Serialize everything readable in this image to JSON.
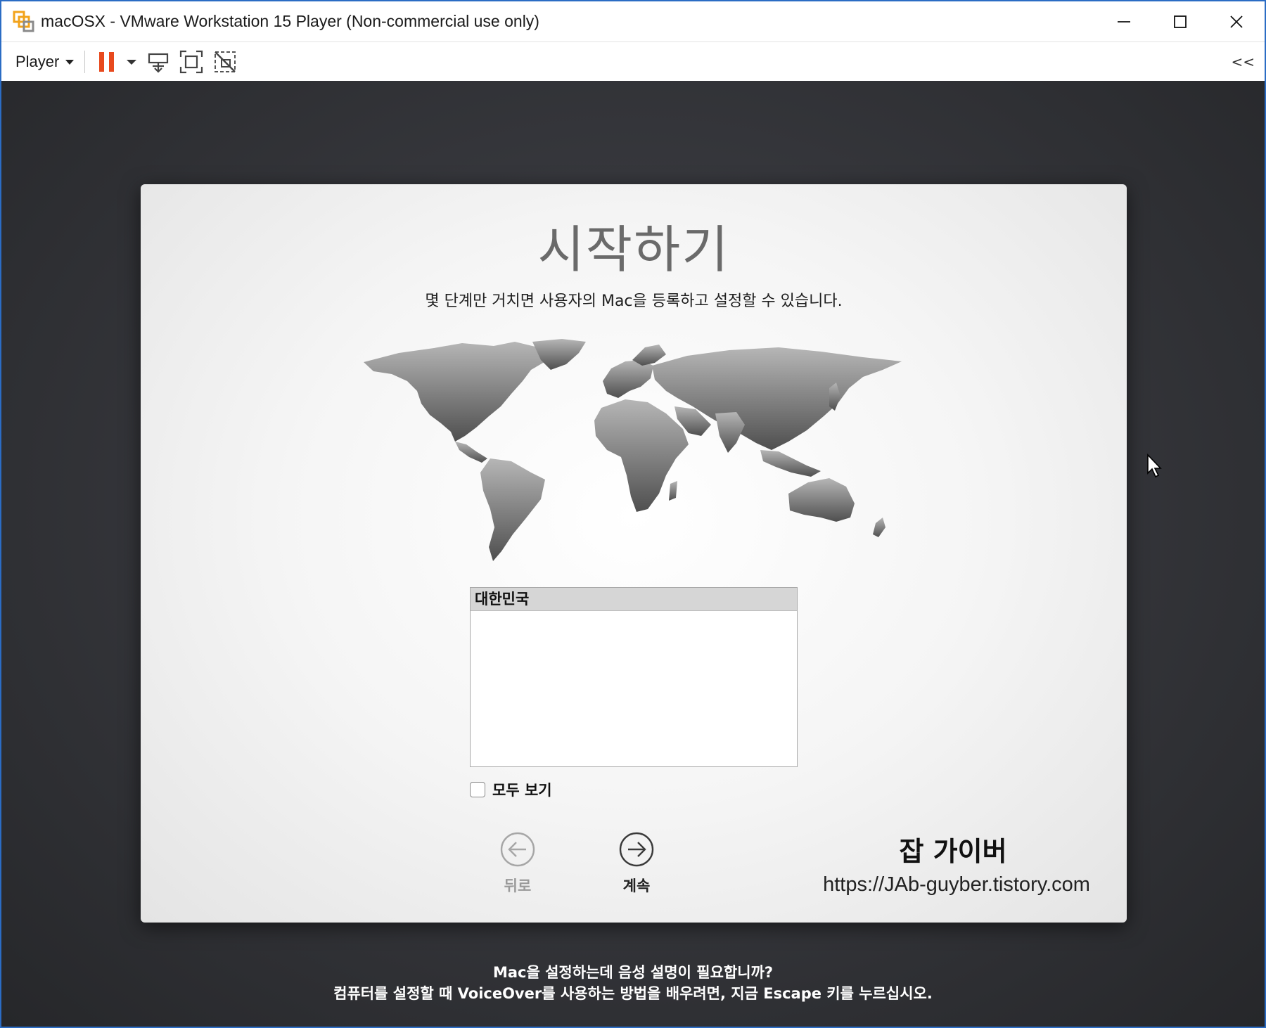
{
  "window": {
    "title": "macOSX - VMware Workstation 15 Player (Non-commercial use only)",
    "controls": [
      "minimize-icon",
      "maximize-icon",
      "close-icon"
    ]
  },
  "toolbar": {
    "player_menu_label": "Player",
    "buttons": [
      "pause-icon",
      "send-ctrl-alt-del-icon",
      "fullscreen-icon",
      "unity-icon"
    ],
    "collapse_label": "<<",
    "accent_color": "#e8491d"
  },
  "setup": {
    "title": "시작하기",
    "subtitle": "몇 단계만 거치면 사용자의 Mac을 등록하고 설정할 수 있습니다.",
    "countries": [
      "대한민국"
    ],
    "selected_country": "대한민국",
    "show_all_label": "모두 보기",
    "show_all_checked": false,
    "back_label": "뒤로",
    "continue_label": "계속"
  },
  "watermark": {
    "title": "잡 가이버",
    "url": "https://JAb-guyber.tistory.com"
  },
  "voiceover": {
    "line1": "Mac을 설정하는데 음성 설명이 필요합니까?",
    "line2": "컴퓨터를 설정할 때 VoiceOver를 사용하는 방법을 배우려면, 지금 Escape 키를 누르십시오."
  }
}
